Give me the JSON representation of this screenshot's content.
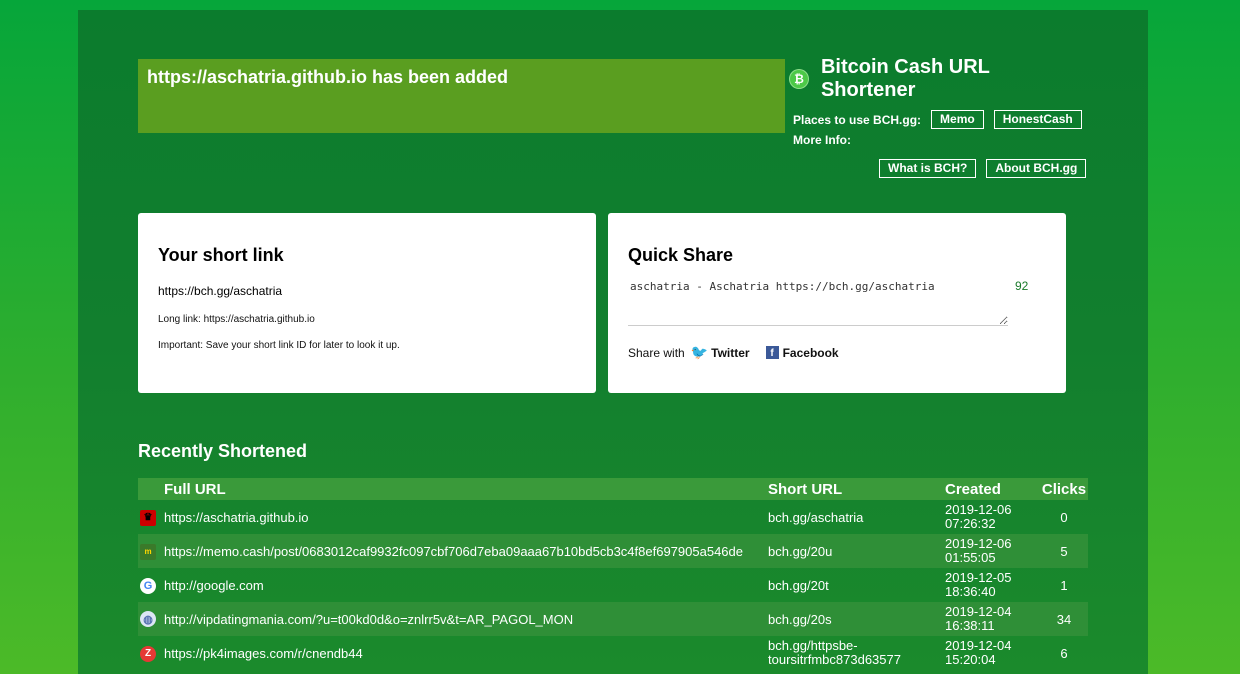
{
  "notice": {
    "text": "https://aschatria.github.io has been added"
  },
  "brand": {
    "icon": "bitcoin-cash-icon",
    "title": "Bitcoin Cash URL Shortener",
    "places_label": "Places to use BCH.gg:",
    "places": [
      "Memo",
      "HonestCash"
    ],
    "more_info_label": "More Info:",
    "info_links": [
      "What is BCH?",
      "About BCH.gg"
    ]
  },
  "short_link": {
    "heading": "Your short link",
    "url": "https://bch.gg/aschatria",
    "long_label": "Long link:",
    "long_url": "https://aschatria.github.io",
    "note": "Important: Save your short link ID for later to look it up."
  },
  "quick_share": {
    "heading": "Quick Share",
    "text": "aschatria - Aschatria https://bch.gg/aschatria",
    "counter": "92",
    "share_label": "Share with",
    "twitter": "Twitter",
    "facebook": "Facebook"
  },
  "recent": {
    "title": "Recently Shortened",
    "headers": [
      "Full URL",
      "Short URL",
      "Created",
      "Clicks"
    ],
    "rows": [
      {
        "icon": "red-crown-icon",
        "full": "https://aschatria.github.io",
        "short": "bch.gg/aschatria",
        "created_date": "2019-12-06",
        "created_time": "07:26:32",
        "clicks": "0"
      },
      {
        "icon": "memo-icon",
        "full": "https://memo.cash/post/0683012caf9932fc097cbf706d7eba09aaa67b10bd5cb3c4f8ef697905a546de",
        "short": "bch.gg/20u",
        "created_date": "2019-12-06",
        "created_time": "01:55:05",
        "clicks": "5"
      },
      {
        "icon": "google-icon",
        "full": "http://google.com",
        "short": "bch.gg/20t",
        "created_date": "2019-12-05",
        "created_time": "18:36:40",
        "clicks": "1"
      },
      {
        "icon": "globe-icon",
        "full": "http://vipdatingmania.com/?u=t00kd0d&o=znlrr5v&t=AR_PAGOL_MON",
        "short": "bch.gg/20s",
        "created_date": "2019-12-04",
        "created_time": "16:38:11",
        "clicks": "34"
      },
      {
        "icon": "z-icon",
        "full": "https://pk4images.com/r/cnendb44",
        "short": "bch.gg/httpsbe-toursitrfmbc873d63577",
        "created_date": "2019-12-04",
        "created_time": "15:20:04",
        "clicks": "6"
      }
    ]
  }
}
